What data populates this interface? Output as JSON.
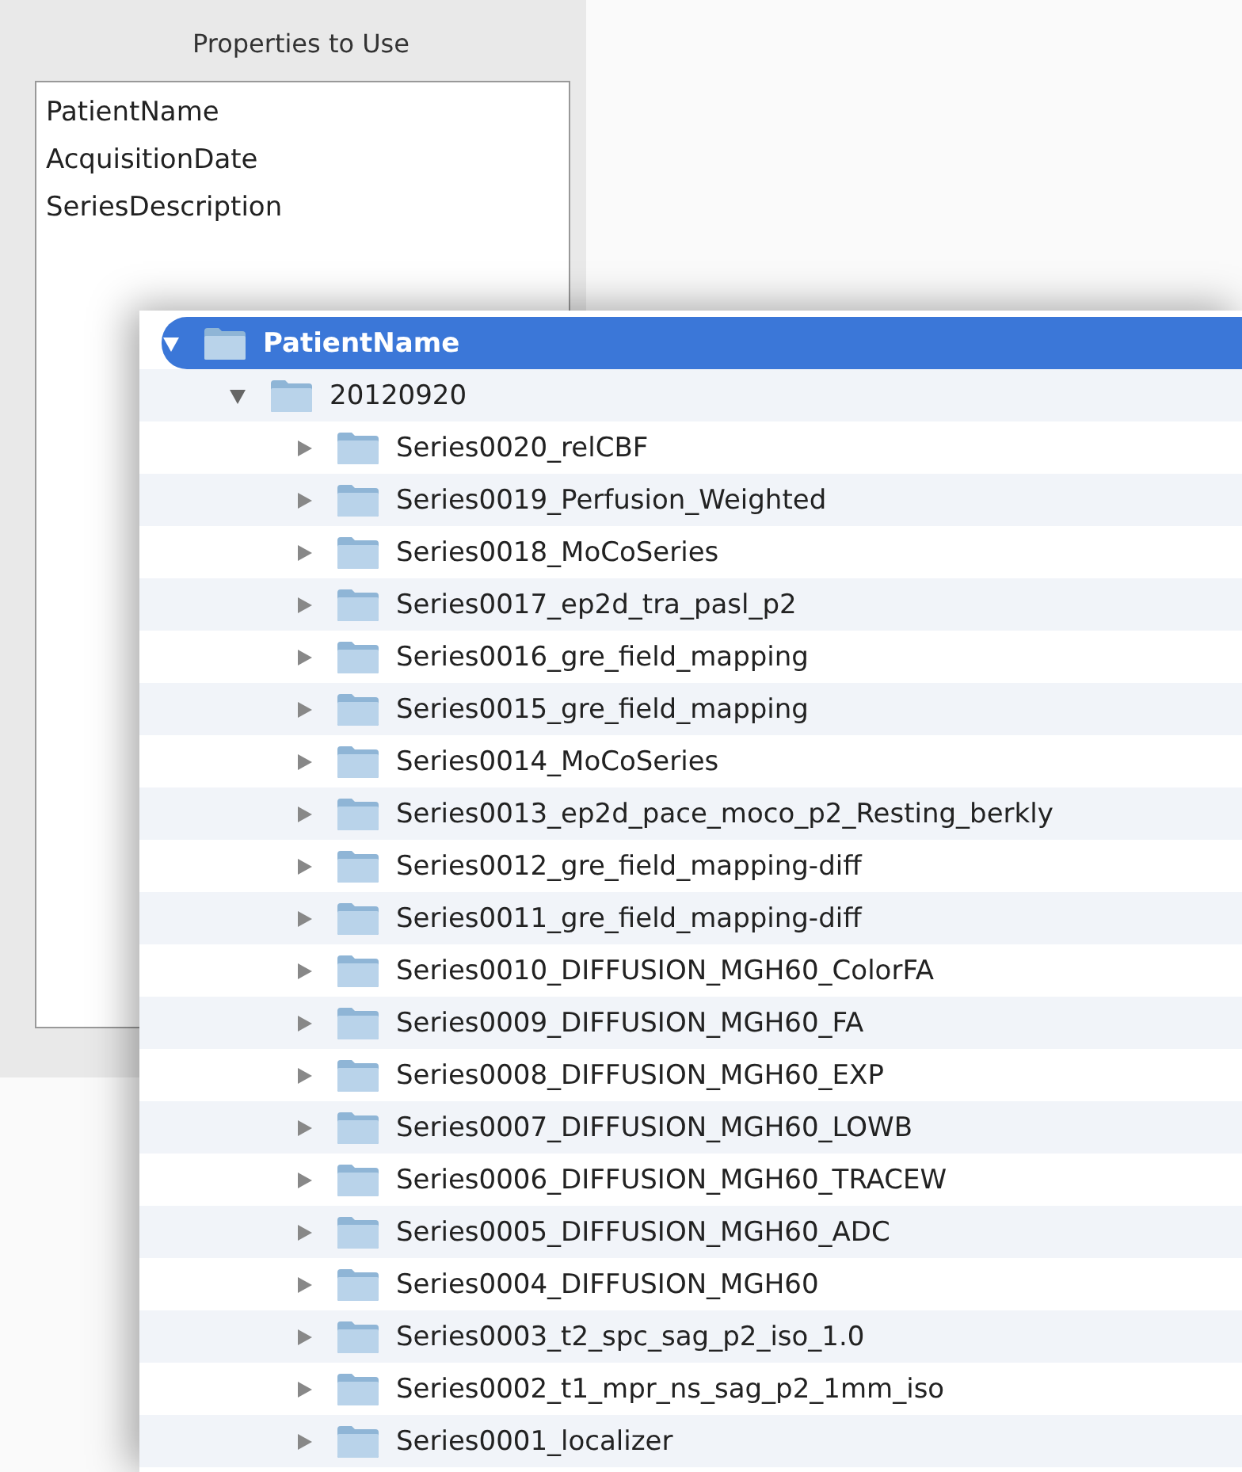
{
  "properties_panel": {
    "title": "Properties to Use",
    "items": [
      "PatientName",
      "AcquisitionDate",
      "SeriesDescription"
    ]
  },
  "tree": [
    {
      "label": "PatientName",
      "expanded": true,
      "selected": true,
      "children": [
        {
          "label": "20120920",
          "expanded": true,
          "selected": false,
          "children": [
            {
              "label": "Series0020_relCBF",
              "expanded": false,
              "selected": false
            },
            {
              "label": "Series0019_Perfusion_Weighted",
              "expanded": false,
              "selected": false
            },
            {
              "label": "Series0018_MoCoSeries",
              "expanded": false,
              "selected": false
            },
            {
              "label": "Series0017_ep2d_tra_pasl_p2",
              "expanded": false,
              "selected": false
            },
            {
              "label": "Series0016_gre_field_mapping",
              "expanded": false,
              "selected": false
            },
            {
              "label": "Series0015_gre_field_mapping",
              "expanded": false,
              "selected": false
            },
            {
              "label": "Series0014_MoCoSeries",
              "expanded": false,
              "selected": false
            },
            {
              "label": "Series0013_ep2d_pace_moco_p2_Resting_berkly",
              "expanded": false,
              "selected": false
            },
            {
              "label": "Series0012_gre_field_mapping-diff",
              "expanded": false,
              "selected": false
            },
            {
              "label": "Series0011_gre_field_mapping-diff",
              "expanded": false,
              "selected": false
            },
            {
              "label": "Series0010_DIFFUSION_MGH60_ColorFA",
              "expanded": false,
              "selected": false
            },
            {
              "label": "Series0009_DIFFUSION_MGH60_FA",
              "expanded": false,
              "selected": false
            },
            {
              "label": "Series0008_DIFFUSION_MGH60_EXP",
              "expanded": false,
              "selected": false
            },
            {
              "label": "Series0007_DIFFUSION_MGH60_LOWB",
              "expanded": false,
              "selected": false
            },
            {
              "label": "Series0006_DIFFUSION_MGH60_TRACEW",
              "expanded": false,
              "selected": false
            },
            {
              "label": "Series0005_DIFFUSION_MGH60_ADC",
              "expanded": false,
              "selected": false
            },
            {
              "label": "Series0004_DIFFUSION_MGH60",
              "expanded": false,
              "selected": false
            },
            {
              "label": "Series0003_t2_spc_sag_p2_iso_1.0",
              "expanded": false,
              "selected": false
            },
            {
              "label": "Series0002_t1_mpr_ns_sag_p2_1mm_iso",
              "expanded": false,
              "selected": false
            },
            {
              "label": "Series0001_localizer",
              "expanded": false,
              "selected": false
            }
          ]
        }
      ]
    }
  ]
}
